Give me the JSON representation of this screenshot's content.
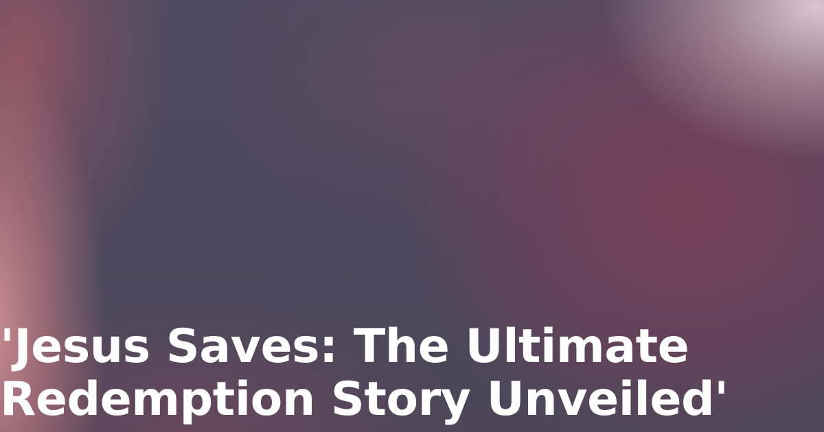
{
  "headline": {
    "line1": "'Jesus Saves: The Ultimate",
    "line2": "Redemption Story Unveiled'"
  }
}
